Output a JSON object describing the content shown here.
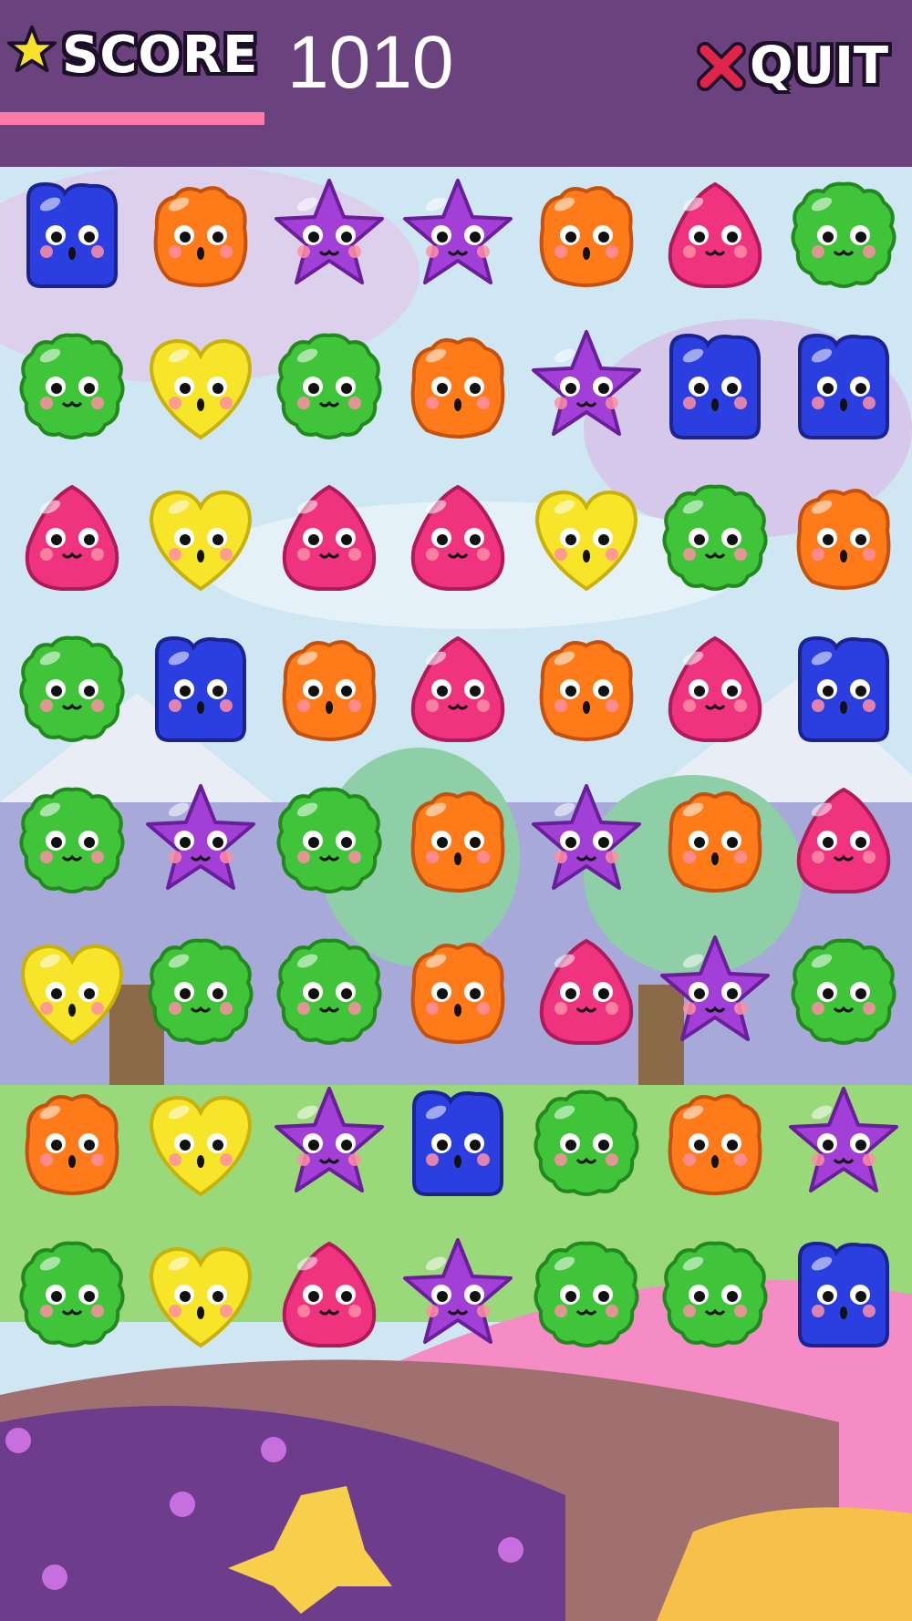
{
  "hud": {
    "score_label": "SCORE",
    "score_value": "1010",
    "quit_label": "QUIT",
    "score_progress": 0.29
  },
  "colors": {
    "header_bg": "#6a427e",
    "progress": "#ff7aa8",
    "candy": {
      "blue": "#2b3fe0",
      "orange": "#ff7a18",
      "purple": "#a23fd6",
      "pink": "#f0337e",
      "green": "#3fc43a",
      "yellow": "#f7e52a"
    }
  },
  "board": {
    "rows": 8,
    "cols": 7,
    "cells": [
      [
        "blue",
        "orange",
        "purple",
        "purple",
        "orange",
        "pink",
        "green"
      ],
      [
        "green",
        "yellow",
        "green",
        "orange",
        "purple",
        "blue",
        "blue"
      ],
      [
        "pink",
        "yellow",
        "pink",
        "pink",
        "yellow",
        "green",
        "orange"
      ],
      [
        "green",
        "blue",
        "orange",
        "pink",
        "orange",
        "pink",
        "blue"
      ],
      [
        "green",
        "purple",
        "green",
        "orange",
        "purple",
        "orange",
        "pink"
      ],
      [
        "yellow",
        "green",
        "green",
        "orange",
        "pink",
        "purple",
        "green"
      ],
      [
        "orange",
        "yellow",
        "purple",
        "blue",
        "green",
        "orange",
        "purple"
      ],
      [
        "green",
        "yellow",
        "pink",
        "purple",
        "green",
        "green",
        "blue"
      ]
    ]
  }
}
